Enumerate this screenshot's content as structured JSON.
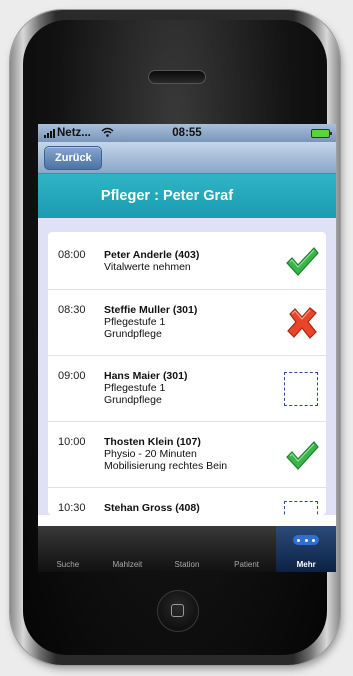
{
  "statusbar": {
    "carrier": "Netz...",
    "time": "08:55",
    "wifi_icon": "wifi-icon",
    "battery_icon": "battery-icon"
  },
  "navbar": {
    "back_label": "Zurück"
  },
  "header": {
    "title": "Pfleger : Peter Graf"
  },
  "appointments": [
    {
      "time": "08:00",
      "name": "Peter Anderle (403)",
      "details": [
        "Vitalwerte nehmen"
      ],
      "status": "done"
    },
    {
      "time": "08:30",
      "name": "Steffie Muller (301)",
      "details": [
        "Pflegestufe 1",
        "Grundpflege"
      ],
      "status": "failed"
    },
    {
      "time": "09:00",
      "name": "Hans Maier (301)",
      "details": [
        "Pflegestufe 1",
        "Grundpflege"
      ],
      "status": "open"
    },
    {
      "time": "10:00",
      "name": "Thosten Klein (107)",
      "details": [
        "Physio - 20 Minuten",
        "Mobilisierung rechtes Bein"
      ],
      "status": "done"
    },
    {
      "time": "10:30",
      "name": "Stehan Gross (408)",
      "details": [],
      "status": "open"
    }
  ],
  "tabs": [
    "Suche",
    "Mahlzeit",
    "Station",
    "Patient",
    "Mehr"
  ],
  "active_tab": "Mehr",
  "colors": {
    "title_bar": "#1fa5b8",
    "list_bg": "#dfe2f7",
    "check": "#39b54a",
    "cross": "#e03a1e",
    "box": "#2f4a9a"
  }
}
